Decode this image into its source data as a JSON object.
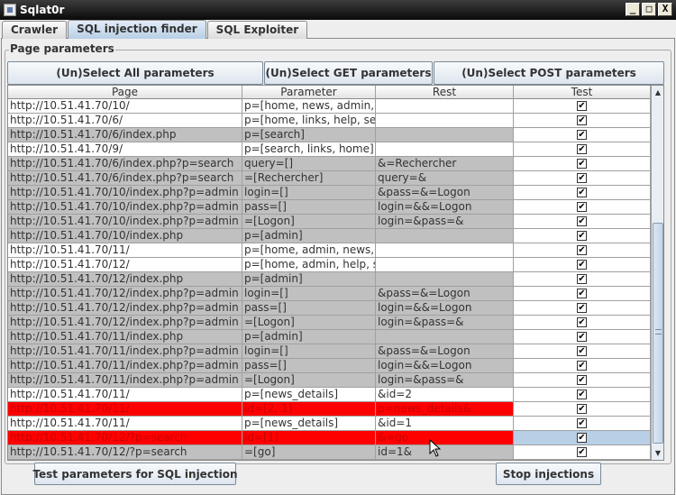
{
  "window": {
    "title": "Sqlat0r",
    "minimize": "_",
    "maximize": "□",
    "close": "X"
  },
  "tabs": [
    {
      "label": "Crawler",
      "active": false
    },
    {
      "label": "SQL injection finder",
      "active": true
    },
    {
      "label": "SQL Exploiter",
      "active": false
    }
  ],
  "panel": {
    "title": "Page parameters"
  },
  "select_buttons": {
    "all": "(Un)Select All parameters",
    "get": "(Un)Select GET parameters",
    "post": "(Un)Select POST parameters"
  },
  "table": {
    "columns": [
      "Page",
      "Parameter",
      "Rest",
      "Test"
    ],
    "rows": [
      {
        "page": "http://10.51.41.70/10/",
        "parameter": "p=[home, news, admin, ...",
        "rest": "",
        "test": true,
        "style": "white"
      },
      {
        "page": "http://10.51.41.70/6/",
        "parameter": "p=[home, links, help, se...",
        "rest": "",
        "test": true,
        "style": "white"
      },
      {
        "page": "http://10.51.41.70/6/index.php",
        "parameter": "p=[search]",
        "rest": "",
        "test": true,
        "style": "grey"
      },
      {
        "page": "http://10.51.41.70/9/",
        "parameter": "p=[search, links, home]",
        "rest": "",
        "test": true,
        "style": "white"
      },
      {
        "page": "http://10.51.41.70/6/index.php?p=search",
        "parameter": "query=[]",
        "rest": "&=Rechercher",
        "test": true,
        "style": "grey"
      },
      {
        "page": "http://10.51.41.70/6/index.php?p=search",
        "parameter": "=[Rechercher]",
        "rest": "query=&",
        "test": true,
        "style": "grey"
      },
      {
        "page": "http://10.51.41.70/10/index.php?p=admin",
        "parameter": "login=[]",
        "rest": "&pass=&=Logon",
        "test": true,
        "style": "grey"
      },
      {
        "page": "http://10.51.41.70/10/index.php?p=admin",
        "parameter": "pass=[]",
        "rest": "login=&&=Logon",
        "test": true,
        "style": "grey"
      },
      {
        "page": "http://10.51.41.70/10/index.php?p=admin",
        "parameter": "=[Logon]",
        "rest": "login=&pass=&",
        "test": true,
        "style": "grey"
      },
      {
        "page": "http://10.51.41.70/10/index.php",
        "parameter": "p=[admin]",
        "rest": "",
        "test": true,
        "style": "grey"
      },
      {
        "page": "http://10.51.41.70/11/",
        "parameter": "p=[home, admin, news, ...",
        "rest": "",
        "test": true,
        "style": "white"
      },
      {
        "page": "http://10.51.41.70/12/",
        "parameter": "p=[home, admin, help, s...",
        "rest": "",
        "test": true,
        "style": "white"
      },
      {
        "page": "http://10.51.41.70/12/index.php",
        "parameter": "p=[admin]",
        "rest": "",
        "test": true,
        "style": "grey"
      },
      {
        "page": "http://10.51.41.70/12/index.php?p=admin",
        "parameter": "login=[]",
        "rest": "&pass=&=Logon",
        "test": true,
        "style": "grey"
      },
      {
        "page": "http://10.51.41.70/12/index.php?p=admin",
        "parameter": "pass=[]",
        "rest": "login=&&=Logon",
        "test": true,
        "style": "grey"
      },
      {
        "page": "http://10.51.41.70/12/index.php?p=admin",
        "parameter": "=[Logon]",
        "rest": "login=&pass=&",
        "test": true,
        "style": "grey"
      },
      {
        "page": "http://10.51.41.70/11/index.php",
        "parameter": "p=[admin]",
        "rest": "",
        "test": true,
        "style": "grey"
      },
      {
        "page": "http://10.51.41.70/11/index.php?p=admin",
        "parameter": "login=[]",
        "rest": "&pass=&=Logon",
        "test": true,
        "style": "grey"
      },
      {
        "page": "http://10.51.41.70/11/index.php?p=admin",
        "parameter": "pass=[]",
        "rest": "login=&&=Logon",
        "test": true,
        "style": "grey"
      },
      {
        "page": "http://10.51.41.70/11/index.php?p=admin",
        "parameter": "=[Logon]",
        "rest": "login=&pass=&",
        "test": true,
        "style": "grey"
      },
      {
        "page": "http://10.51.41.70/11/",
        "parameter": "p=[news_details]",
        "rest": "&id=2",
        "test": true,
        "style": "white"
      },
      {
        "page": "http://10.51.41.70/11/",
        "parameter": "id=[2, 1]",
        "rest": "p=news_details&",
        "test": true,
        "style": "red"
      },
      {
        "page": "http://10.51.41.70/11/",
        "parameter": "p=[news_details]",
        "rest": "&id=1",
        "test": true,
        "style": "white"
      },
      {
        "page": "http://10.51.41.70/12/?p=search",
        "parameter": "id=[1]",
        "rest": "&=go",
        "test": true,
        "style": "red",
        "selected": true
      },
      {
        "page": "http://10.51.41.70/12/?p=search",
        "parameter": "=[go]",
        "rest": "id=1&",
        "test": true,
        "style": "grey"
      }
    ]
  },
  "scrollbar": {
    "up_icon": "▲",
    "down_icon": "▼"
  },
  "footer_buttons": {
    "test": "Test parameters for SQL injection",
    "stop": "Stop injections"
  },
  "colors": {
    "vulnerable_row": "#ff0000",
    "post_row": "#c0c0c0",
    "get_row": "#ffffff"
  }
}
